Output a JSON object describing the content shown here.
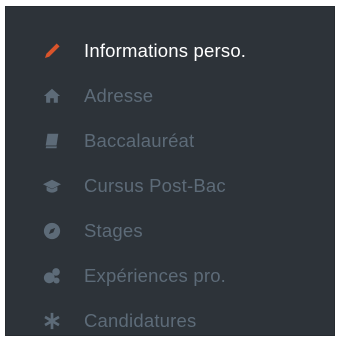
{
  "sidebar": {
    "items": [
      {
        "label": "Informations perso.",
        "icon": "pencil-icon",
        "active": true
      },
      {
        "label": "Adresse",
        "icon": "home-icon",
        "active": false
      },
      {
        "label": "Baccalauréat",
        "icon": "book-icon",
        "active": false
      },
      {
        "label": "Cursus Post-Bac",
        "icon": "graduation-cap-icon",
        "active": false
      },
      {
        "label": "Stages",
        "icon": "compass-icon",
        "active": false
      },
      {
        "label": "Expériences pro.",
        "icon": "cogs-icon",
        "active": false
      },
      {
        "label": "Candidatures",
        "icon": "asterisk-icon",
        "active": false
      }
    ]
  },
  "colors": {
    "background": "#2d3339",
    "text": "#5d6b78",
    "active_text": "#ffffff",
    "accent": "#d9542b"
  }
}
